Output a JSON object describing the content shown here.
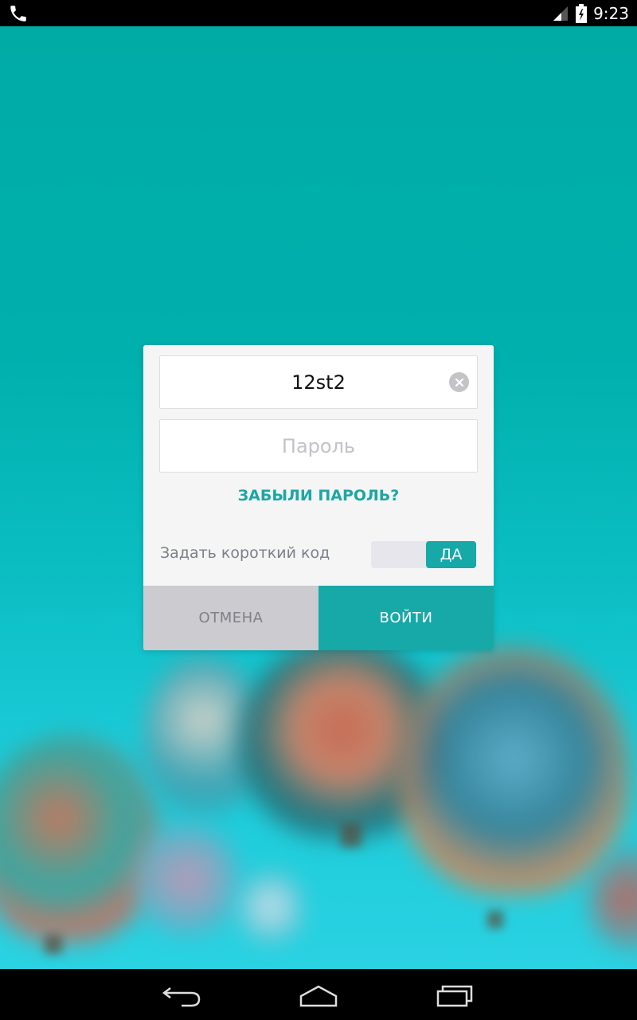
{
  "status_bar": {
    "time": "9:23",
    "icons": [
      "phone-icon",
      "signal-icon",
      "battery-icon"
    ]
  },
  "dialog": {
    "login_field": {
      "value": "12st2"
    },
    "password_field": {
      "placeholder": "Пароль"
    },
    "forgot_password_label": "ЗАБЫЛИ ПАРОЛЬ?",
    "short_code": {
      "label": "Задать короткий код",
      "toggle_value": "ДА"
    },
    "cancel_label": "ОТМЕНА",
    "login_label": "ВОЙТИ"
  },
  "nav_bar": {
    "icons": [
      "back-icon",
      "home-icon",
      "recent-apps-icon"
    ]
  },
  "colors": {
    "accent": "#17a9a7",
    "background_top": "#00aba6",
    "background_bottom": "#2ad2e2"
  }
}
